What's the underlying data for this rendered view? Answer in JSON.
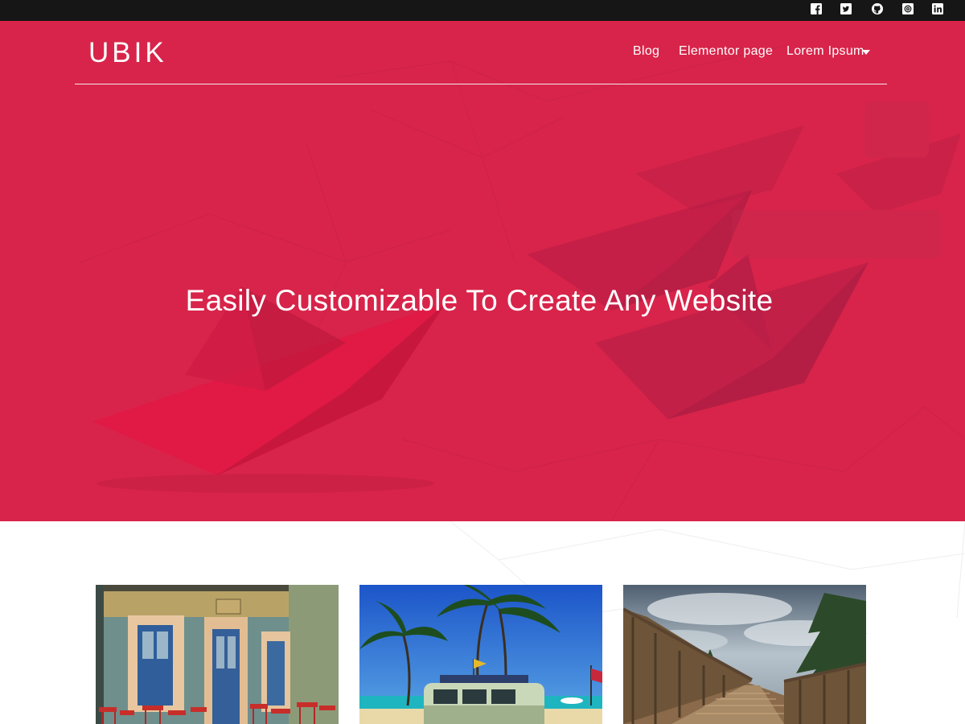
{
  "header": {
    "social_icons": [
      "facebook-icon",
      "twitter-icon",
      "github-icon",
      "email-icon",
      "linkedin-icon"
    ],
    "logo": "UBIK",
    "nav": [
      {
        "label": "Blog"
      },
      {
        "label": "Elementor page"
      },
      {
        "label": "Lorem Ipsum",
        "has_dropdown": true
      }
    ]
  },
  "hero": {
    "headline": "Easily Customizable To Create Any Website"
  },
  "cards": [
    {
      "image": "colorful-building-facade-with-red-chairs"
    },
    {
      "image": "palm-trees-and-vintage-van-on-beach"
    },
    {
      "image": "wooden-boardwalk-under-cloudy-sky"
    }
  ],
  "colors": {
    "topbar": "#161616",
    "hero_background": "#d8244a",
    "text_on_hero": "#ffffff",
    "page_background": "#ffffff"
  }
}
